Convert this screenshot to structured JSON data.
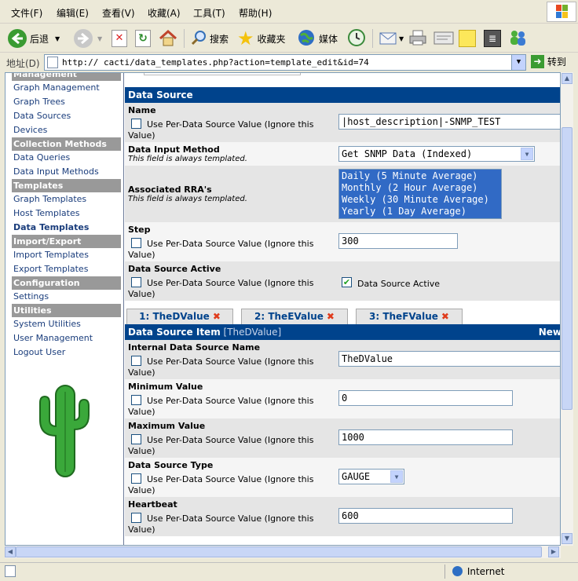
{
  "menu": [
    "文件(F)",
    "编辑(E)",
    "查看(V)",
    "收藏(A)",
    "工具(T)",
    "帮助(H)"
  ],
  "toolbar": {
    "back": "后退",
    "search": "搜索",
    "favorites": "收藏夹",
    "media": "媒体"
  },
  "address": {
    "label": "地址(D)",
    "url": "http://          cacti/data_templates.php?action=template_edit&id=74",
    "go": "转到"
  },
  "sidebar": {
    "items": [
      {
        "type": "cat",
        "label": "Management"
      },
      {
        "type": "link",
        "label": "Graph Management"
      },
      {
        "type": "link",
        "label": "Graph Trees"
      },
      {
        "type": "link",
        "label": "Data Sources"
      },
      {
        "type": "link",
        "label": "Devices"
      },
      {
        "type": "cat",
        "label": "Collection Methods"
      },
      {
        "type": "link",
        "label": "Data Queries"
      },
      {
        "type": "link",
        "label": "Data Input Methods"
      },
      {
        "type": "cat",
        "label": "Templates"
      },
      {
        "type": "link",
        "label": "Graph Templates"
      },
      {
        "type": "link",
        "label": "Host Templates"
      },
      {
        "type": "link",
        "label": "Data Templates",
        "selected": true
      },
      {
        "type": "cat",
        "label": "Import/Export"
      },
      {
        "type": "link",
        "label": "Import Templates"
      },
      {
        "type": "link",
        "label": "Export Templates"
      },
      {
        "type": "cat",
        "label": "Configuration"
      },
      {
        "type": "link",
        "label": "Settings"
      },
      {
        "type": "cat",
        "label": "Utilities"
      },
      {
        "type": "link",
        "label": "System Utilities"
      },
      {
        "type": "link",
        "label": "User Management"
      },
      {
        "type": "link",
        "label": "Logout User"
      }
    ]
  },
  "ds": {
    "header": "Data Source",
    "per_ds": "Use Per-Data Source Value (Ignore this",
    "per_ds2": "Value)",
    "name_label": "Name",
    "name_value": "|host_description|-SNMP_TEST",
    "input_label": "Data Input Method",
    "templated": "This field is always templated.",
    "input_value": "Get SNMP Data (Indexed)",
    "rra_label": "Associated RRA's",
    "rras": [
      "Daily (5 Minute Average)",
      "Monthly (2 Hour Average)",
      "Weekly (30 Minute Average)",
      "Yearly (1 Day Average)"
    ],
    "step_label": "Step",
    "step_value": "300",
    "active_label": "Data Source Active",
    "active_cb": "Data Source Active"
  },
  "tabs": [
    "1: TheDValue",
    "2: TheEValue",
    "3: TheFValue"
  ],
  "item": {
    "header": "Data Source Item",
    "sub": "[TheDValue]",
    "new": "New",
    "internal_label": "Internal Data Source Name",
    "internal_value": "TheDValue",
    "min_label": "Minimum Value",
    "min_value": "0",
    "max_label": "Maximum Value",
    "max_value": "1000",
    "type_label": "Data Source Type",
    "type_value": "GAUGE",
    "hb_label": "Heartbeat",
    "hb_value": "600"
  },
  "status": {
    "zone": "Internet"
  },
  "colors": {
    "header": "#00438c",
    "sidebar_cat": "#999999",
    "link": "#1a3d7c",
    "tab_x": "#e03b1c",
    "list_sel": "#316ac5"
  }
}
